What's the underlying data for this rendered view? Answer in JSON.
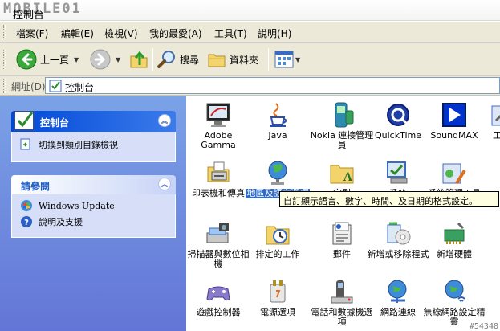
{
  "window": {
    "title": "控制台",
    "watermark": "MOBILE01"
  },
  "menu": [
    "檔案(F)",
    "編輯(E)",
    "檢視(V)",
    "我的最愛(A)",
    "工具(T)",
    "說明(H)"
  ],
  "toolbar": {
    "back_label": "上一頁",
    "search_label": "搜尋",
    "folders_label": "資料夾"
  },
  "address": {
    "label": "網址(D)",
    "value": "控制台"
  },
  "leftpane": {
    "cp_panel": {
      "title": "控制台",
      "task_label": "切換到類別目錄檢視"
    },
    "see_also": {
      "title": "請參閱",
      "items": [
        "Windows Update",
        "說明及支援"
      ]
    }
  },
  "icons": [
    {
      "label": "Adobe Gamma",
      "icon": "monitor-icon"
    },
    {
      "label": "Java",
      "icon": "java-cup-icon"
    },
    {
      "label": "Nokia 連接管理員",
      "icon": "nokia-phone-icon"
    },
    {
      "label": "QuickTime",
      "icon": "quicktime-icon"
    },
    {
      "label": "SoundMAX",
      "icon": "play-icon"
    },
    {
      "label": "工",
      "icon": "tools-icon"
    },
    {
      "label": "印表機和傳真",
      "icon": "printer-icon"
    },
    {
      "label": "地區及語言選項",
      "icon": "globe-icon"
    },
    {
      "label": "字型",
      "icon": "fonts-folder-icon"
    },
    {
      "label": "系統",
      "icon": "system-icon"
    },
    {
      "label": "系統管理工具",
      "icon": "admin-tools-icon"
    },
    {
      "label": "掃描器與數位相機",
      "icon": "scanner-camera-icon"
    },
    {
      "label": "排定的工作",
      "icon": "scheduled-tasks-icon"
    },
    {
      "label": "郵件",
      "icon": "mail-icon"
    },
    {
      "label": "新增或移除程式",
      "icon": "add-remove-programs-icon"
    },
    {
      "label": "新增硬體",
      "icon": "add-hardware-icon"
    },
    {
      "label": "遊戲控制器",
      "icon": "game-controller-icon"
    },
    {
      "label": "電源選項",
      "icon": "power-options-icon"
    },
    {
      "label": "電話和數據機選項",
      "icon": "phone-modem-icon"
    },
    {
      "label": "網路連線",
      "icon": "network-connections-icon"
    },
    {
      "label": "無線網路設定精靈",
      "icon": "wireless-wizard-icon"
    }
  ],
  "tooltip": "自訂顯示語言、數字、時間、及日期的格式設定。",
  "corner_watermark": "#54348"
}
